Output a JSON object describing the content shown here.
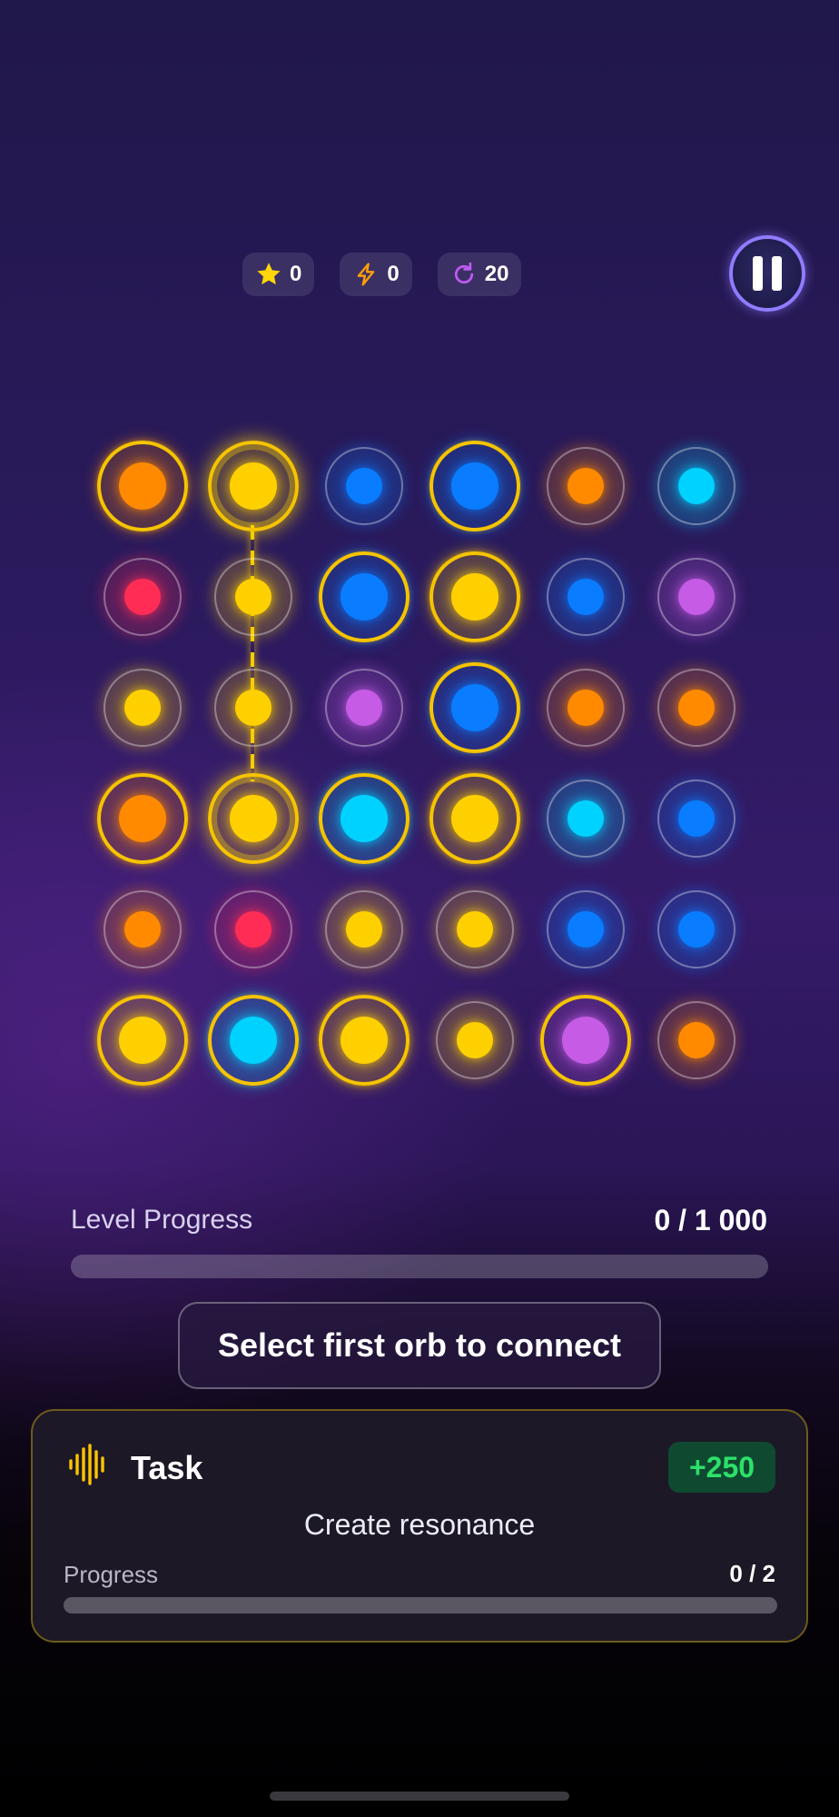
{
  "stats": [
    {
      "icon": "star-icon",
      "value": "0",
      "color": "#FFD60A"
    },
    {
      "icon": "lightning-icon",
      "value": "0",
      "color": "#FF9F0A"
    },
    {
      "icon": "moves-icon",
      "value": "20",
      "color": "#BF5AF2"
    }
  ],
  "pause_icon": "pause-icon",
  "colors": {
    "orange": "#FF8A00",
    "yellow": "#FFD000",
    "blue": "#0A7CFF",
    "cyan": "#00D2FF",
    "red": "#FF2D55",
    "purple": "#C65BE6",
    "gold_ring": "#F5C400",
    "connector": "#FFD600"
  },
  "board": {
    "rows": [
      [
        {
          "c": "orange",
          "s": "gold"
        },
        {
          "c": "yellow",
          "s": "selected"
        },
        {
          "c": "blue",
          "s": "normal"
        },
        {
          "c": "blue",
          "s": "gold"
        },
        {
          "c": "orange",
          "s": "normal"
        },
        {
          "c": "cyan",
          "s": "normal"
        }
      ],
      [
        {
          "c": "red",
          "s": "normal"
        },
        {
          "c": "yellow",
          "s": "normal"
        },
        {
          "c": "blue",
          "s": "gold"
        },
        {
          "c": "yellow",
          "s": "gold"
        },
        {
          "c": "blue",
          "s": "normal"
        },
        {
          "c": "purple",
          "s": "normal"
        }
      ],
      [
        {
          "c": "yellow",
          "s": "normal"
        },
        {
          "c": "yellow",
          "s": "normal"
        },
        {
          "c": "purple",
          "s": "normal"
        },
        {
          "c": "blue",
          "s": "gold"
        },
        {
          "c": "orange",
          "s": "normal"
        },
        {
          "c": "orange",
          "s": "normal"
        }
      ],
      [
        {
          "c": "orange",
          "s": "gold"
        },
        {
          "c": "yellow",
          "s": "selected"
        },
        {
          "c": "cyan",
          "s": "gold"
        },
        {
          "c": "yellow",
          "s": "gold"
        },
        {
          "c": "cyan",
          "s": "normal"
        },
        {
          "c": "blue",
          "s": "normal"
        }
      ],
      [
        {
          "c": "orange",
          "s": "normal"
        },
        {
          "c": "red",
          "s": "normal"
        },
        {
          "c": "yellow",
          "s": "normal"
        },
        {
          "c": "yellow",
          "s": "normal"
        },
        {
          "c": "blue",
          "s": "normal"
        },
        {
          "c": "blue",
          "s": "normal"
        }
      ],
      [
        {
          "c": "yellow",
          "s": "gold"
        },
        {
          "c": "cyan",
          "s": "gold"
        },
        {
          "c": "yellow",
          "s": "gold"
        },
        {
          "c": "yellow",
          "s": "normal"
        },
        {
          "c": "purple",
          "s": "gold"
        },
        {
          "c": "orange",
          "s": "normal"
        }
      ]
    ],
    "connection": {
      "column": 2,
      "from_row": 1,
      "to_row": 4
    }
  },
  "level_progress": {
    "label": "Level Progress",
    "value_text": "0 / 1 000",
    "current": 0,
    "total": 1000
  },
  "hint": "Select first orb to connect",
  "task": {
    "icon": "sound-wave-icon",
    "title": "Task",
    "reward": "+250",
    "description": "Create resonance",
    "progress_label": "Progress",
    "progress_text": "0 / 2",
    "current": 0,
    "total": 2
  }
}
